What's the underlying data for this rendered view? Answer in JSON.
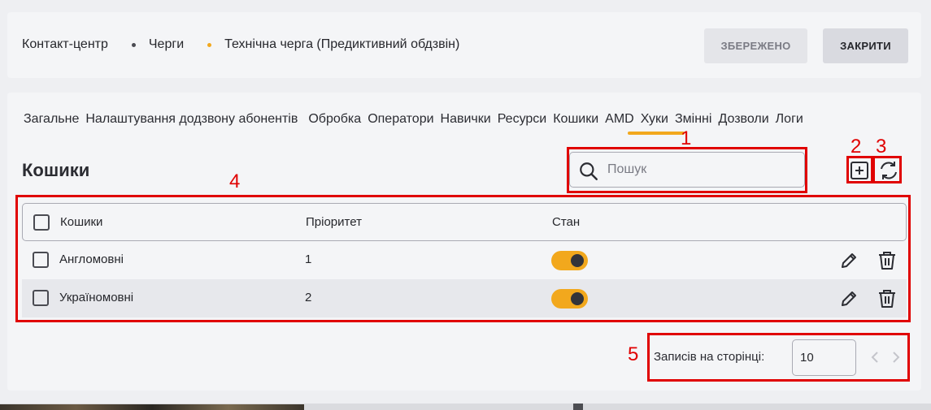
{
  "breadcrumbs": [
    "Контакт-центр",
    "Черги",
    "Технічна черга (Предиктивний обдзвін)"
  ],
  "header_buttons": {
    "saved": "ЗБЕРЕЖЕНО",
    "close": "ЗАКРИТИ"
  },
  "tabs": [
    "Загальне",
    "Налаштування додзвону абонентів",
    "Обробка",
    "Оператори",
    "Навички",
    "Ресурси",
    "Кошики",
    "AMD",
    "Хуки",
    "Змінні",
    "Дозволи",
    "Логи"
  ],
  "active_tab": "Кошики",
  "section_title": "Кошики",
  "search": {
    "placeholder": "Пошук"
  },
  "table": {
    "headers": [
      "Кошики",
      "Пріоритет",
      "Стан"
    ],
    "rows": [
      {
        "name": "Англомовні",
        "priority": "1",
        "enabled": true
      },
      {
        "name": "Україномовні",
        "priority": "2",
        "enabled": true
      }
    ]
  },
  "pagination": {
    "label": "Записів на сторінці:",
    "per_page": "10"
  },
  "annotations": [
    "1",
    "2",
    "3",
    "4",
    "5"
  ],
  "colors": {
    "accent": "#f2a81d",
    "annotation": "#e00000",
    "background": "#eeeff2",
    "panel": "#f4f5f7"
  },
  "icons": [
    "search-icon",
    "add-icon",
    "refresh-icon",
    "edit-icon",
    "trash-icon",
    "chevron-left-icon",
    "chevron-right-icon"
  ]
}
